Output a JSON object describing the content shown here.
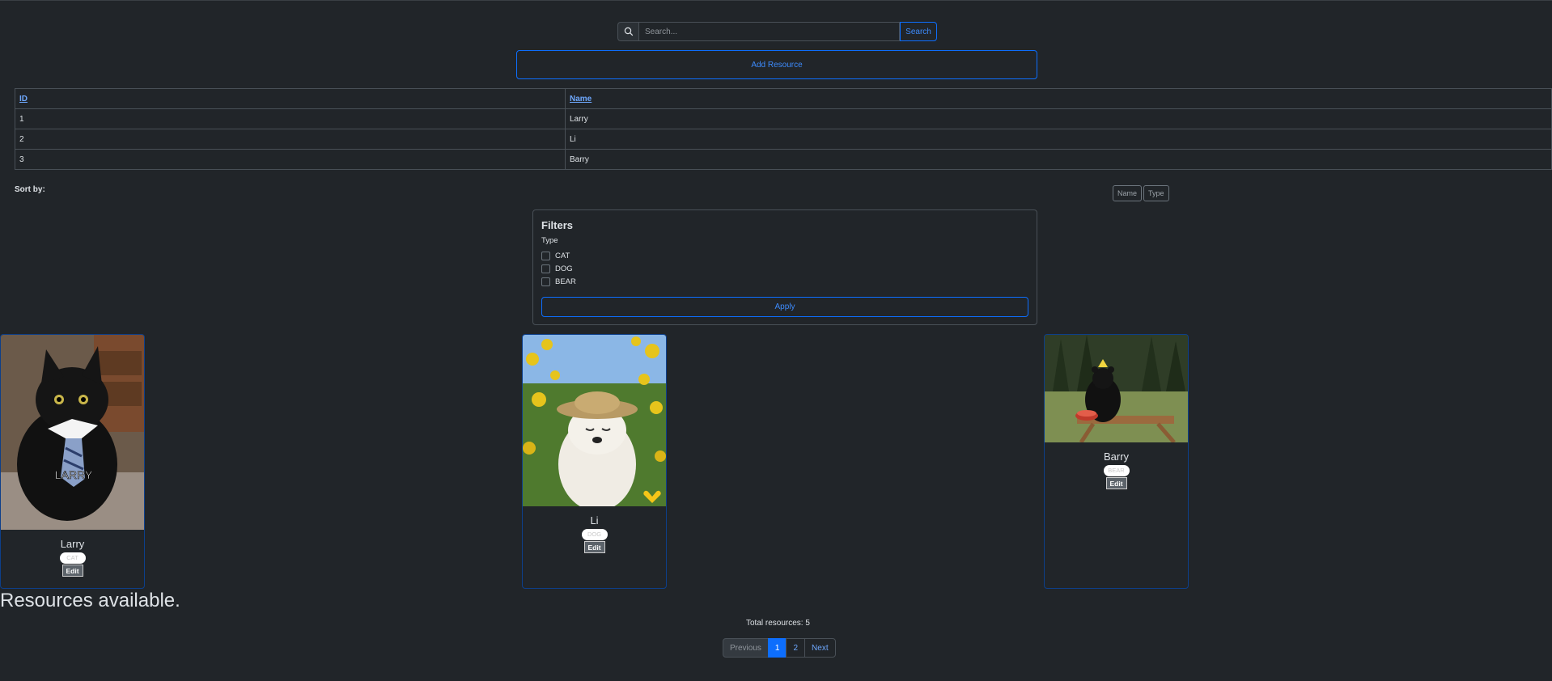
{
  "search": {
    "placeholder": "Search...",
    "button_label": "Search"
  },
  "add_button_label": "Add Resource",
  "table": {
    "headers": [
      "ID",
      "Name"
    ],
    "rows": [
      {
        "id": "1",
        "name": "Larry"
      },
      {
        "id": "2",
        "name": "Li"
      },
      {
        "id": "3",
        "name": "Barry"
      }
    ]
  },
  "sort": {
    "label": "Sort by:",
    "options": [
      "Name",
      "Type"
    ]
  },
  "filters": {
    "title": "Filters",
    "type_label": "Type",
    "options": [
      "CAT",
      "DOG",
      "BEAR"
    ],
    "apply_label": "Apply"
  },
  "cards": [
    {
      "name": "Larry",
      "type": "CAT",
      "edit_label": "Edit",
      "image_caption": "LARRY",
      "image_icon": "cat-photo"
    },
    {
      "name": "Li",
      "type": "DOG",
      "edit_label": "Edit",
      "image_icon": "dog-photo"
    },
    {
      "name": "Barry",
      "type": "BEAR",
      "edit_label": "Edit",
      "image_icon": "bear-photo"
    }
  ],
  "resources_heading": "Resources available.",
  "total_text": "Total resources: 5",
  "pagination": {
    "previous": "Previous",
    "pages": [
      "1",
      "2"
    ],
    "next": "Next"
  }
}
